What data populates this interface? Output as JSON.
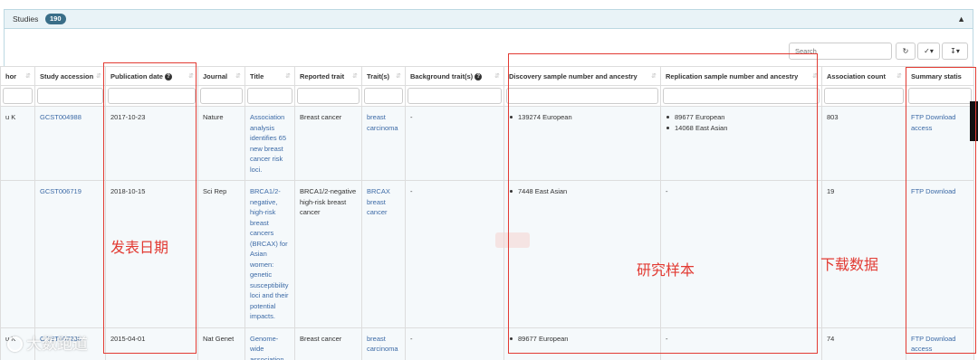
{
  "panel": {
    "title": "Studies",
    "count": "190",
    "collapse_icon": "chevron-up-icon"
  },
  "toolbar": {
    "search_placeholder": "Search",
    "refresh_icon": "refresh-icon",
    "columns_icon": "check-columns-icon",
    "export_icon": "download-icon"
  },
  "columns": [
    "hor",
    "Study accession",
    "Publication date",
    "Journal",
    "Title",
    "Reported trait",
    "Trait(s)",
    "Background trait(s)",
    "Discovery sample number and ancestry",
    "Replication sample number and ancestry",
    "Association count",
    "Summary statis"
  ],
  "rows": [
    {
      "author": "u K",
      "accession": "GCST004988",
      "date": "2017-10-23",
      "journal": "Nature",
      "title": "Association analysis identifies 65 new breast cancer risk loci.",
      "reported_trait": "Breast cancer",
      "trait": "breast carcinoma",
      "background": "-",
      "discovery": [
        "139274 European"
      ],
      "replication": [
        "89677 European",
        "14068 East Asian"
      ],
      "assoc_count": "803",
      "summary": "FTP Download",
      "summary2": "access"
    },
    {
      "author": "",
      "accession": "GCST006719",
      "date": "2018-10-15",
      "journal": "Sci Rep",
      "title": "BRCA1/2-negative, high-risk breast cancers (BRCAX) for Asian women: genetic susceptibility loci and their potential impacts.",
      "reported_trait": "BRCA1/2-negative high-risk breast cancer",
      "trait": "BRCAX breast cancer",
      "background": "-",
      "discovery": [
        "7448 East Asian"
      ],
      "replication_text": "-",
      "assoc_count": "19",
      "summary": "FTP Download",
      "summary2": ""
    },
    {
      "author": "u K",
      "accession": "GCST007236",
      "date": "2015-04-01",
      "journal": "Nat Genet",
      "title": "Genome-wide association",
      "reported_trait": "Breast cancer",
      "trait": "breast carcinoma",
      "background": "-",
      "discovery": [
        "89677 European"
      ],
      "replication_text": "-",
      "assoc_count": "74",
      "summary": "FTP Download",
      "summary2": "access"
    }
  ],
  "annotations": {
    "pub_date": "发表日期",
    "samples": "研究样本",
    "download": "下载数据"
  },
  "watermark": "大数跑道",
  "colors": {
    "annotation": "#e23b33",
    "link": "#3c6aa6",
    "badge": "#3a6e88",
    "panel_header": "#e9f3f7"
  }
}
